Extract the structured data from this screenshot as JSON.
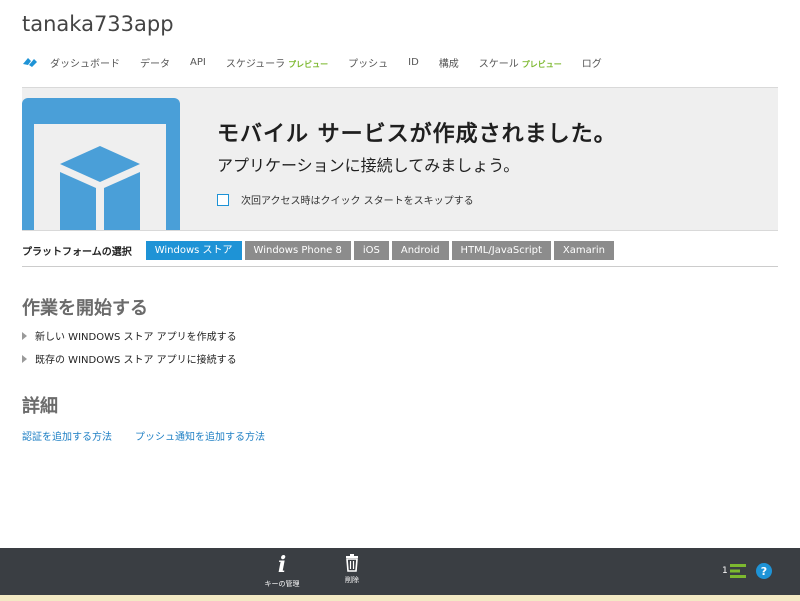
{
  "app": {
    "title": "tanaka733app"
  },
  "nav": {
    "items": [
      {
        "label": "ダッシュボード",
        "preview": ""
      },
      {
        "label": "データ",
        "preview": ""
      },
      {
        "label": "API",
        "preview": ""
      },
      {
        "label": "スケジューラ",
        "preview": "プレビュー"
      },
      {
        "label": "プッシュ",
        "preview": ""
      },
      {
        "label": "ID",
        "preview": ""
      },
      {
        "label": "構成",
        "preview": ""
      },
      {
        "label": "スケール",
        "preview": "プレビュー"
      },
      {
        "label": "ログ",
        "preview": ""
      }
    ]
  },
  "banner": {
    "headline": "モバイル サービスが作成されました。",
    "subtitle": "アプリケーションに接続してみましょう。",
    "skip_label": "次回アクセス時はクイック スタートをスキップする"
  },
  "platform": {
    "label": "プラットフォームの選択",
    "tabs": [
      "Windows ストア",
      "Windows Phone 8",
      "iOS",
      "Android",
      "HTML/JavaScript",
      "Xamarin"
    ],
    "active": "Windows ストア"
  },
  "get_started": {
    "title": "作業を開始する",
    "items": [
      "新しい WINDOWS ストア アプリを作成する",
      "既存の WINDOWS ストア アプリに接続する"
    ]
  },
  "details": {
    "title": "詳細",
    "links": [
      "認証を追加する方法",
      "プッシュ通知を追加する方法"
    ]
  },
  "bottombar": {
    "manage_keys": "キーの管理",
    "delete": "削除",
    "notification_count": "1",
    "help": "?"
  },
  "colors": {
    "accent": "#1e93d6",
    "preview": "#7cb82f",
    "bar": "#3a3e43"
  }
}
